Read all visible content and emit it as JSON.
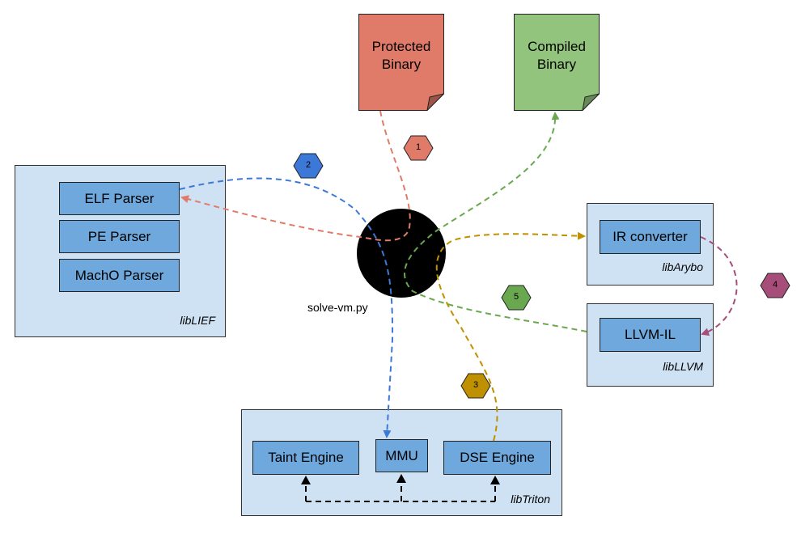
{
  "documents": [
    {
      "id": "protected",
      "label_line1": "Protected",
      "label_line2": "Binary",
      "color": "#e07b6a"
    },
    {
      "id": "compiled",
      "label_line1": "Compiled",
      "label_line2": "Binary",
      "color": "#93c47d"
    }
  ],
  "center": {
    "label": "solve-vm.py"
  },
  "libraries": {
    "liblief": {
      "label": "libLIEF",
      "components": [
        "ELF Parser",
        "PE Parser",
        "MachO Parser"
      ]
    },
    "libarybo": {
      "label": "libArybo",
      "components": [
        "IR converter"
      ]
    },
    "libllvm": {
      "label": "libLLVM",
      "components": [
        "LLVM-IL"
      ]
    },
    "libtriton": {
      "label": "libTriton",
      "components": [
        "Taint Engine",
        "MMU",
        "DSE Engine"
      ]
    }
  },
  "steps": [
    {
      "number": "1",
      "color": "#e07b6a"
    },
    {
      "number": "2",
      "color": "#3c78d8"
    },
    {
      "number": "3",
      "color": "#bf9000"
    },
    {
      "number": "4",
      "color": "#a64d79"
    },
    {
      "number": "5",
      "color": "#6aa84f"
    }
  ],
  "colors": {
    "library_bg": "#cfe2f3",
    "component_bg": "#6fa8dc"
  }
}
